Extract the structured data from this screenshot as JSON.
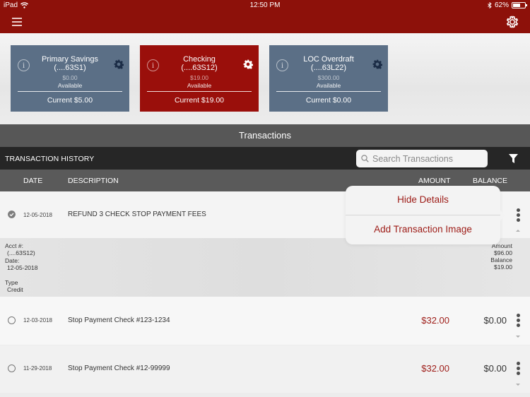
{
  "status_bar": {
    "device": "iPad",
    "time": "12:50 PM",
    "battery_percent": "62%",
    "battery_level": 0.62
  },
  "nav": {
    "menu_icon": "hamburger-icon",
    "settings_icon": "gear-icon"
  },
  "accounts": [
    {
      "name": "Primary Savings",
      "number": "(....63S1)",
      "available_amount": "$0.00",
      "available_label": "Available",
      "current": "Current $5.00",
      "selected": false
    },
    {
      "name": "Checking",
      "number": "(....63S12)",
      "available_amount": "$19.00",
      "available_label": "Available",
      "current": "Current $19.00",
      "selected": true
    },
    {
      "name": "LOC Overdraft",
      "number": "(....63L22)",
      "available_amount": "$300.00",
      "available_label": "Available",
      "current": "Current $0.00",
      "selected": false
    }
  ],
  "transactions_header": "Transactions",
  "history": {
    "title": "TRANSACTION HISTORY",
    "search_placeholder": "Search Transactions",
    "search_value": ""
  },
  "columns": {
    "date": "DATE",
    "description": "DESCRIPTION",
    "amount": "AMOUNT",
    "balance": "BALANCE"
  },
  "transactions": [
    {
      "date": "12-05-2018",
      "description": "REFUND 3 CHECK STOP PAYMENT FEES",
      "amount": "",
      "balance": "",
      "selected": true,
      "expanded": true,
      "details": {
        "acct_label": "Acct #:",
        "acct_value": "(....63S12)",
        "date_label": "Date:",
        "date_value": "12-05-2018",
        "type_label": "Type",
        "type_value": "Credit",
        "amount_label": "Amount",
        "amount_value": "$96.00",
        "balance_label": "Balance",
        "balance_value": "$19.00"
      }
    },
    {
      "date": "12-03-2018",
      "description": "Stop Payment Check #123-1234",
      "amount": "$32.00",
      "balance": "$0.00",
      "selected": false,
      "expanded": false
    },
    {
      "date": "11-29-2018",
      "description": "Stop Payment Check #12-99999",
      "amount": "$32.00",
      "balance": "$0.00",
      "selected": false,
      "expanded": false
    }
  ],
  "popover_menu": {
    "items": [
      "Hide Details",
      "Add Transaction Image"
    ]
  },
  "colors": {
    "brand_red": "#8d110a",
    "account_card": "#5b6f86",
    "account_card_active": "#9a0f0b",
    "amount_red": "#9d1b16"
  }
}
